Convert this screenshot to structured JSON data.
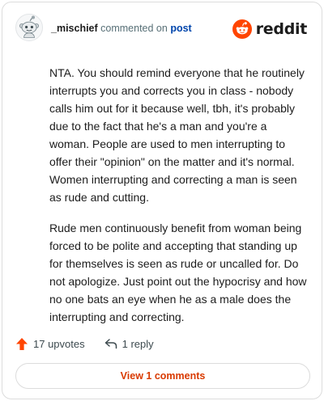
{
  "comment": {
    "username": "_mischief",
    "commented_on_text": "commented on",
    "post_link": "post",
    "brand": "reddit",
    "paragraphs": [
      "NTA. You should remind everyone that he routinely interrupts you and corrects you in class - nobody calls him out for it because well, tbh, it's probably due to the fact that he's a man and you're a woman. People are used to men interrupting to offer their \"opinion\" on the matter and it's normal. Women interrupting and correcting a man is seen as rude and cutting.",
      "Rude men continuously benefit from woman being forced to be polite and accepting that standing up for themselves is seen as rude or uncalled for. Do not apologize. Just point out the hypocrisy and how no one bats an eye when he as a male does the interrupting and correcting."
    ],
    "upvotes_label": "17 upvotes",
    "reply_label": "1 reply",
    "view_comments_label": "View 1 comments"
  },
  "colors": {
    "brand_orange": "#ff4500",
    "upvote_orange": "#ff4500",
    "link_blue": "#0045ac",
    "button_text": "#d93a00"
  },
  "icons": {
    "avatar": "snoo-avatar-icon",
    "logo": "reddit-logo-icon",
    "upvote": "upvote-arrow-icon",
    "reply": "reply-arrow-icon"
  }
}
